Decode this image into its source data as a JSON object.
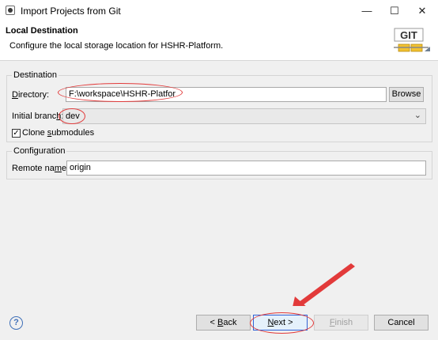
{
  "window": {
    "title": "Import Projects from Git",
    "minimize_glyph": "—",
    "maximize_glyph": "☐",
    "close_glyph": "✕"
  },
  "header": {
    "title": "Local Destination",
    "description": "Configure the local storage location for HSHR-Platform.",
    "logo_text": "GIT"
  },
  "destination": {
    "group_label": "Destination",
    "directory_label_u": "D",
    "directory_label_rest": "irectory:",
    "directory_value": "F:\\workspace\\HSHR-Platfor",
    "browse_label": "Browse",
    "initial_branch_label": "Initial branc",
    "initial_branch_label_u": "h",
    "initial_branch_label_end": ":",
    "initial_branch_value": "dev",
    "clone_submodules_prefix": "Clone ",
    "clone_submodules_u": "s",
    "clone_submodules_rest": "ubmodules",
    "clone_submodules_checked": true
  },
  "configuration": {
    "group_label": "Configuration",
    "remote_name_label": "Remote na",
    "remote_name_label_u": "m",
    "remote_name_label_end": "e:",
    "remote_name_value": "origin"
  },
  "footer": {
    "help_glyph": "?",
    "back_prefix": "< ",
    "back_u": "B",
    "back_rest": "ack",
    "next_u": "N",
    "next_rest": "ext >",
    "finish_u": "F",
    "finish_rest": "inish",
    "cancel_label": "Cancel"
  },
  "colors": {
    "annotation_red": "#e23a3a",
    "annotation_blue": "#2f62d6"
  }
}
